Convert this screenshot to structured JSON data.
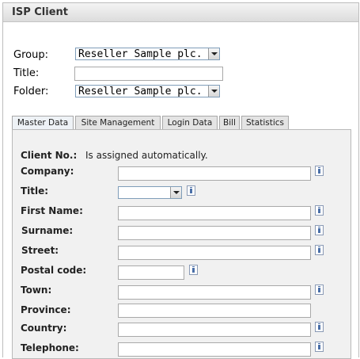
{
  "panel": {
    "title": "ISP Client"
  },
  "group": {
    "label": "Group:",
    "value": "Reseller Sample plc."
  },
  "title_field": {
    "label": "Title:",
    "value": ""
  },
  "folder": {
    "label": "Folder:",
    "value": "Reseller Sample plc."
  },
  "tabs": [
    {
      "label": "Master Data",
      "active": true
    },
    {
      "label": "Site Management",
      "active": false
    },
    {
      "label": "Login Data",
      "active": false
    },
    {
      "label": "Bill",
      "active": false
    },
    {
      "label": "Statistics",
      "active": false
    }
  ],
  "form": {
    "client_no": {
      "label": "Client No.:",
      "value": "Is assigned automatically."
    },
    "company": {
      "label": "Company:",
      "value": ""
    },
    "title": {
      "label": "Title:",
      "value": ""
    },
    "first_name": {
      "label": "First Name:",
      "value": ""
    },
    "surname": {
      "label": "Surname:",
      "value": ""
    },
    "street": {
      "label": "Street:",
      "value": ""
    },
    "postal_code": {
      "label": "Postal code:",
      "value": ""
    },
    "town": {
      "label": "Town:",
      "value": ""
    },
    "province": {
      "label": "Province:",
      "value": ""
    },
    "country": {
      "label": "Country:",
      "value": ""
    },
    "telephone": {
      "label": "Telephone:",
      "value": ""
    }
  }
}
